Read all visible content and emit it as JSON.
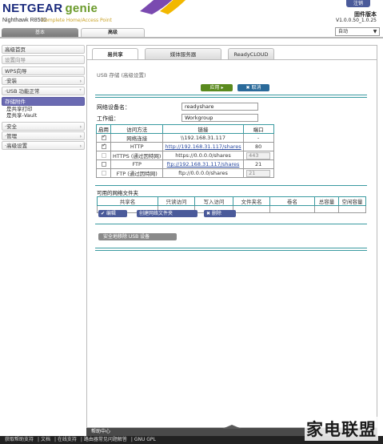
{
  "header": {
    "brand_main": "NETGEAR",
    "brand_accent": "genie",
    "model": "Nighthawk R8500",
    "subtitle": "Complete Home/Access Point",
    "logout": "注销",
    "firmware_label": "固件版本",
    "firmware_version": "V1.0.0.50_1.0.25"
  },
  "tabs": {
    "basic": "基本",
    "advanced": "高级"
  },
  "language": {
    "selected": "自动"
  },
  "sidebar": {
    "items": [
      {
        "label": "高级首页",
        "state": "normal"
      },
      {
        "label": "设置向导",
        "state": "gray"
      },
      {
        "label": "WPS向导",
        "state": "normal"
      },
      {
        "label": "·安装",
        "state": "normal"
      },
      {
        "label": "·USB 功能正常",
        "state": "normal"
      },
      {
        "label": "存储附件",
        "state": "selected"
      },
      {
        "label": "·安全",
        "state": "normal"
      },
      {
        "label": "·管理",
        "state": "normal"
      },
      {
        "label": "·高级设置",
        "state": "normal"
      }
    ],
    "subitems": [
      "是共享打印",
      "是共享-Vault"
    ]
  },
  "panel": {
    "tabs": [
      "易共享",
      "媒体服务器",
      "ReadyCLOUD"
    ],
    "usb_title": "USB 存储 (高级设置)",
    "apply_label": "应用 ▸",
    "cancel_label": "✖ 取消",
    "device_name_label": "网络设备名：",
    "device_name_value": "readyshare",
    "workgroup_label": "工作组：",
    "workgroup_value": "Workgroup",
    "access_table": {
      "headers": [
        "启用",
        "访问方法",
        "链接",
        "端口"
      ],
      "rows": [
        {
          "enabled": true,
          "disabled": false,
          "method": "网络连接",
          "link": "\\\\192.168.31.117",
          "link_is_url": false,
          "port": "-"
        },
        {
          "enabled": true,
          "disabled": false,
          "method": "HTTP",
          "link": "http://192.168.31.117/shares",
          "link_is_url": true,
          "port": "80"
        },
        {
          "enabled": false,
          "disabled": true,
          "method": "HTTPS (通过因特网)",
          "link": "https://0.0.0.0/shares",
          "link_is_url": false,
          "port": "443"
        },
        {
          "enabled": false,
          "disabled": false,
          "method": "FTP",
          "link": "ftp://192.168.31.117/shares",
          "link_is_url": true,
          "port": "21"
        },
        {
          "enabled": false,
          "disabled": true,
          "method": "FTP (通过因特网)",
          "link": "ftp://0.0.0.0/shares",
          "link_is_url": false,
          "port": "21"
        }
      ]
    },
    "share_title": "可用的网络文件夹",
    "share_table": {
      "headers": [
        "共享名",
        "只读访问",
        "写入访问",
        "文件夹名",
        "卷名",
        "总容量",
        "空闲容量"
      ]
    },
    "edit_label": "✔ 编辑",
    "create_label": "创建网络文件夹",
    "delete_label": "✖ 删除",
    "safe_remove_label": "安全地移除 USB 设备"
  },
  "footer": {
    "help_center": "帮助中心",
    "links": [
      "获取帮助支持",
      "文档",
      "在线支持",
      "路由器常见问题解答",
      "GNU GPL"
    ],
    "watermark": "家电联盟"
  },
  "colors": {
    "brand_blue": "#1a2a7c",
    "brand_green": "#6a9a2a",
    "accent_teal": "#3a9aa0",
    "sidebar_selected": "#6a6ab2",
    "apply_green": "#5a8a1e",
    "footer_dark": "#222222"
  }
}
